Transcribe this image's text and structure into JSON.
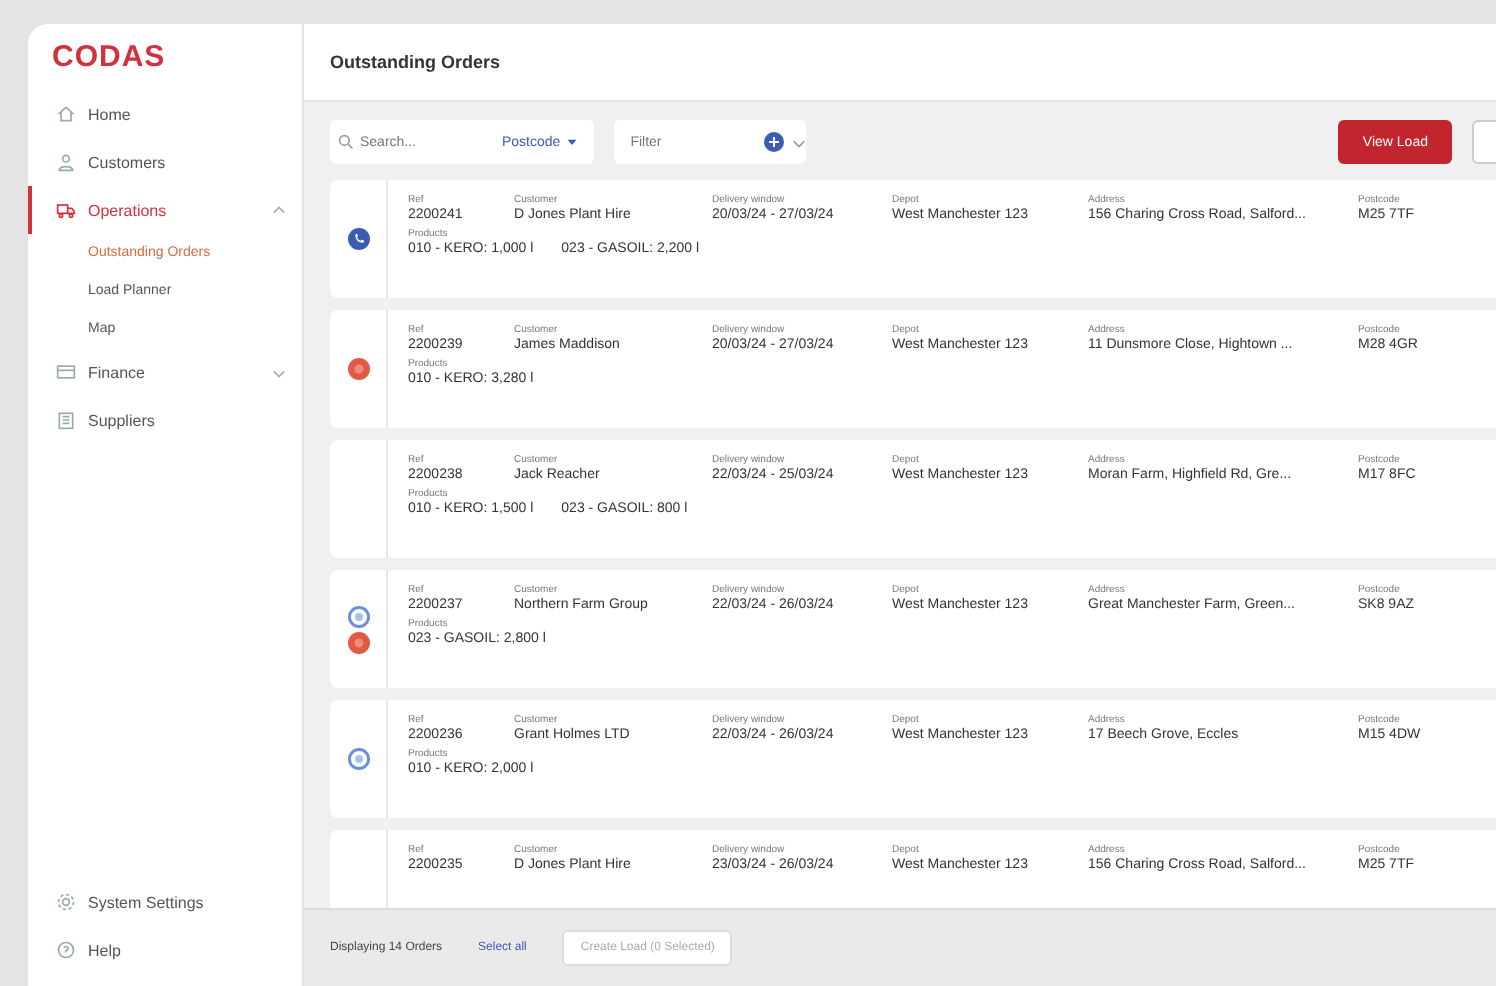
{
  "brand": "CODAS",
  "sidebar": {
    "items": [
      {
        "label": "Home",
        "kind": "home",
        "selected": false,
        "expandable": false
      },
      {
        "label": "Customers",
        "kind": "person",
        "selected": false,
        "expandable": false
      },
      {
        "label": "Operations",
        "kind": "truck",
        "selected": true,
        "expandable": true,
        "expanded": true,
        "children": [
          {
            "label": "Outstanding Orders",
            "selected": true
          },
          {
            "label": "Load Planner",
            "selected": false
          },
          {
            "label": "Map",
            "selected": false
          }
        ]
      },
      {
        "label": "Finance",
        "kind": "card",
        "selected": false,
        "expandable": true,
        "expanded": false
      },
      {
        "label": "Suppliers",
        "kind": "building",
        "selected": false,
        "expandable": false
      }
    ],
    "bottom": [
      {
        "label": "System Settings",
        "kind": "gear"
      },
      {
        "label": "Help",
        "kind": "help"
      }
    ]
  },
  "header": {
    "title": "Outstanding Orders"
  },
  "toolbar": {
    "search": {
      "placeholder": "Search..."
    },
    "postcode": {
      "label": "Postcode"
    },
    "filter": {
      "placeholder": "Filter"
    },
    "view_load": "View Load"
  },
  "orders": [
    {
      "markers": [
        {
          "kind": "phone"
        }
      ],
      "fields": [
        {
          "label": "Ref",
          "value": "2200241"
        },
        {
          "label": "Customer",
          "value": "D Jones Plant Hire"
        },
        {
          "label": "Delivery window",
          "value": "20/03/24 - 27/03/24"
        },
        {
          "label": "Depot",
          "value": "West Manchester 123"
        },
        {
          "label": "Address",
          "value": "156 Charing Cross Road, Salford..."
        },
        {
          "label": "Postcode",
          "value": "M25 7TF"
        }
      ],
      "products": {
        "label": "Products",
        "items": [
          "010 - KERO: 1,000 l",
          "023 - GASOIL: 2,200 l"
        ]
      }
    },
    {
      "markers": [
        {
          "kind": "alert"
        }
      ],
      "fields": [
        {
          "label": "Ref",
          "value": "2200239"
        },
        {
          "label": "Customer",
          "value": "James Maddison"
        },
        {
          "label": "Delivery window",
          "value": "20/03/24 - 27/03/24"
        },
        {
          "label": "Depot",
          "value": "West Manchester 123"
        },
        {
          "label": "Address",
          "value": "11 Dunsmore Close, Hightown ..."
        },
        {
          "label": "Postcode",
          "value": "M28 4GR"
        }
      ],
      "products": {
        "label": "Products",
        "items": [
          "010 - KERO: 3,280 l"
        ]
      }
    },
    {
      "fields": [
        {
          "label": "Ref",
          "value": "2200238"
        },
        {
          "label": "Customer",
          "value": "Jack Reacher"
        },
        {
          "label": "Delivery window",
          "value": "22/03/24 - 25/03/24"
        },
        {
          "label": "Depot",
          "value": "West Manchester 123"
        },
        {
          "label": "Address",
          "value": "Moran Farm, Highfield Rd, Gre..."
        },
        {
          "label": "Postcode",
          "value": "M17 8FC"
        }
      ],
      "products": {
        "label": "Products",
        "items": [
          "010 - KERO: 1,500 l",
          "023 - GASOIL: 800 l"
        ]
      }
    },
    {
      "markers": [
        {
          "kind": "ring"
        },
        {
          "kind": "alert"
        }
      ],
      "fields": [
        {
          "label": "Ref",
          "value": "2200237"
        },
        {
          "label": "Customer",
          "value": "Northern Farm Group"
        },
        {
          "label": "Delivery window",
          "value": "22/03/24 - 26/03/24"
        },
        {
          "label": "Depot",
          "value": "West Manchester 123"
        },
        {
          "label": "Address",
          "value": "Great Manchester Farm, Green..."
        },
        {
          "label": "Postcode",
          "value": "SK8 9AZ"
        }
      ],
      "products": {
        "label": "Products",
        "items": [
          "023 - GASOIL: 2,800 l"
        ]
      }
    },
    {
      "markers": [
        {
          "kind": "ring"
        }
      ],
      "fields": [
        {
          "label": "Ref",
          "value": "2200236"
        },
        {
          "label": "Customer",
          "value": "Grant Holmes LTD"
        },
        {
          "label": "Delivery window",
          "value": "22/03/24 - 26/03/24"
        },
        {
          "label": "Depot",
          "value": "West Manchester 123"
        },
        {
          "label": "Address",
          "value": "17 Beech Grove, Eccles"
        },
        {
          "label": "Postcode",
          "value": "M15 4DW"
        }
      ],
      "products": {
        "label": "Products",
        "items": [
          "010 - KERO: 2,000 l"
        ]
      }
    },
    {
      "fields": [
        {
          "label": "Ref",
          "value": "2200235"
        },
        {
          "label": "Customer",
          "value": "D Jones Plant Hire"
        },
        {
          "label": "Delivery window",
          "value": "23/03/24 - 26/03/24"
        },
        {
          "label": "Depot",
          "value": "West Manchester 123"
        },
        {
          "label": "Address",
          "value": "156 Charing Cross Road, Salford..."
        },
        {
          "label": "Postcode",
          "value": "M25 7TF"
        }
      ]
    }
  ],
  "footer": {
    "count": "Displaying 14 Orders",
    "select_all": "Select all",
    "create": {
      "label": "Create Load (0 Selected)",
      "disabled": true
    }
  }
}
